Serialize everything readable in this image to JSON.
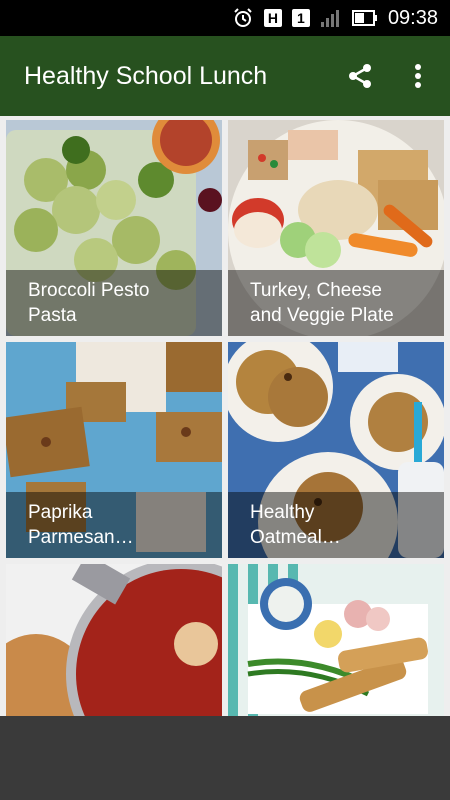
{
  "status_bar": {
    "time": "09:38",
    "icons": [
      "alarm-icon",
      "h-network-icon",
      "sim-1-icon",
      "signal-icon",
      "battery-icon"
    ],
    "h_label": "H",
    "sim_label": "1"
  },
  "app_bar": {
    "title": "Healthy School Lunch",
    "share_icon": "share-icon",
    "menu_icon": "more-vert-icon",
    "color": "#27511f"
  },
  "recipes": [
    {
      "line1": "Broccoli Pesto",
      "line2": "Pasta"
    },
    {
      "line1": "Turkey, Cheese",
      "line2": "and Veggie Plate"
    },
    {
      "line1": "Paprika",
      "line2": "Parmesan…"
    },
    {
      "line1": "Healthy",
      "line2": "Oatmeal…"
    },
    {
      "line1": "",
      "line2": ""
    },
    {
      "line1": "",
      "line2": ""
    }
  ]
}
